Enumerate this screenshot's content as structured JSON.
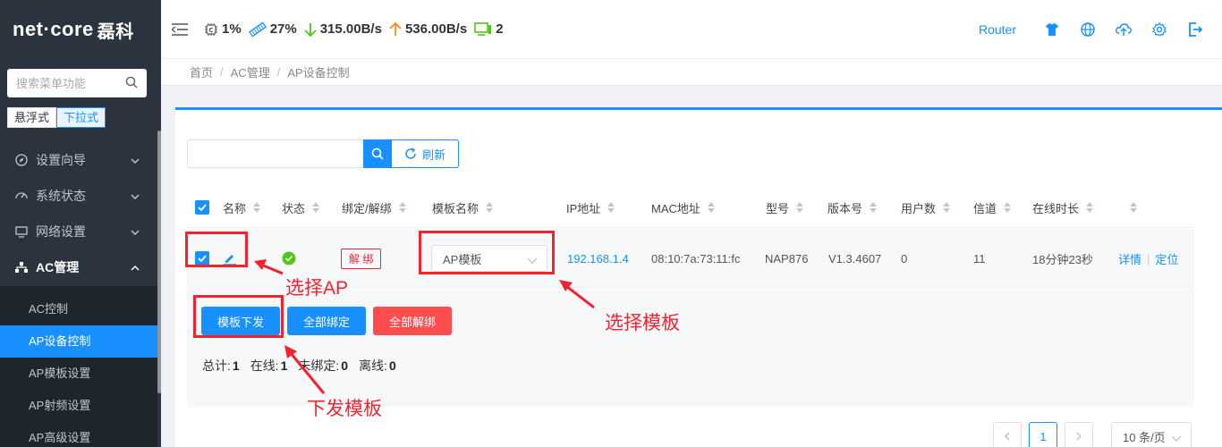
{
  "logo": {
    "brand": "net·core",
    "brand_cn": "磊科"
  },
  "sidebar": {
    "search_placeholder": "搜索菜单功能",
    "mode_float": "悬浮式",
    "mode_dropdown": "下拉式",
    "menu": [
      {
        "label": "设置向导",
        "icon": "compass-icon"
      },
      {
        "label": "系统状态",
        "icon": "dashboard-icon"
      },
      {
        "label": "网络设置",
        "icon": "monitor-icon"
      },
      {
        "label": "AC管理",
        "icon": "tree-icon"
      }
    ],
    "submenu": [
      "AC控制",
      "AP设备控制",
      "AP模板设置",
      "AP射频设置",
      "AP高级设置"
    ],
    "active_sub": "AP设备控制"
  },
  "header": {
    "cpu": "1%",
    "memory": "27%",
    "download": "315.00B/s",
    "upload": "536.00B/s",
    "clients": "2",
    "router_label": "Router"
  },
  "breadcrumb": [
    "首页",
    "AC管理",
    "AP设备控制"
  ],
  "toolbar": {
    "refresh_label": "刷新",
    "search_value": ""
  },
  "table": {
    "columns": [
      "名称",
      "状态",
      "绑定/解绑",
      "模板名称",
      "IP地址",
      "MAC地址",
      "型号",
      "版本号",
      "用户数",
      "信道",
      "在线时长"
    ],
    "rows": [
      {
        "bind_action": "解 绑",
        "template": "AP模板",
        "ip": "192.168.1.4",
        "mac": "08:10:7a:73:11:fc",
        "model": "NAP876",
        "version": "V1.3.4607",
        "users": "0",
        "channel": "11",
        "uptime": "18分钟23秒",
        "op_detail": "详情",
        "op_locate": "定位"
      }
    ]
  },
  "actions": {
    "push_template": "模板下发",
    "bind_all": "全部绑定",
    "unbind_all": "全部解绑"
  },
  "summary": {
    "total_label": "总计:",
    "total": "1",
    "online_label": "在线:",
    "online": "1",
    "unbound_label": "未绑定:",
    "unbound": "0",
    "offline_label": "离线:",
    "offline": "0"
  },
  "pagination": {
    "current": "1",
    "page_size": "10 条/页"
  },
  "annotations": {
    "select_ap": "选择AP",
    "select_template": "选择模板",
    "push_template": "下发模板"
  },
  "colors": {
    "accent": "#1890ff",
    "danger": "#ff4d4f",
    "annotation": "#f5222d",
    "sidebar_bg": "#2b333e"
  }
}
